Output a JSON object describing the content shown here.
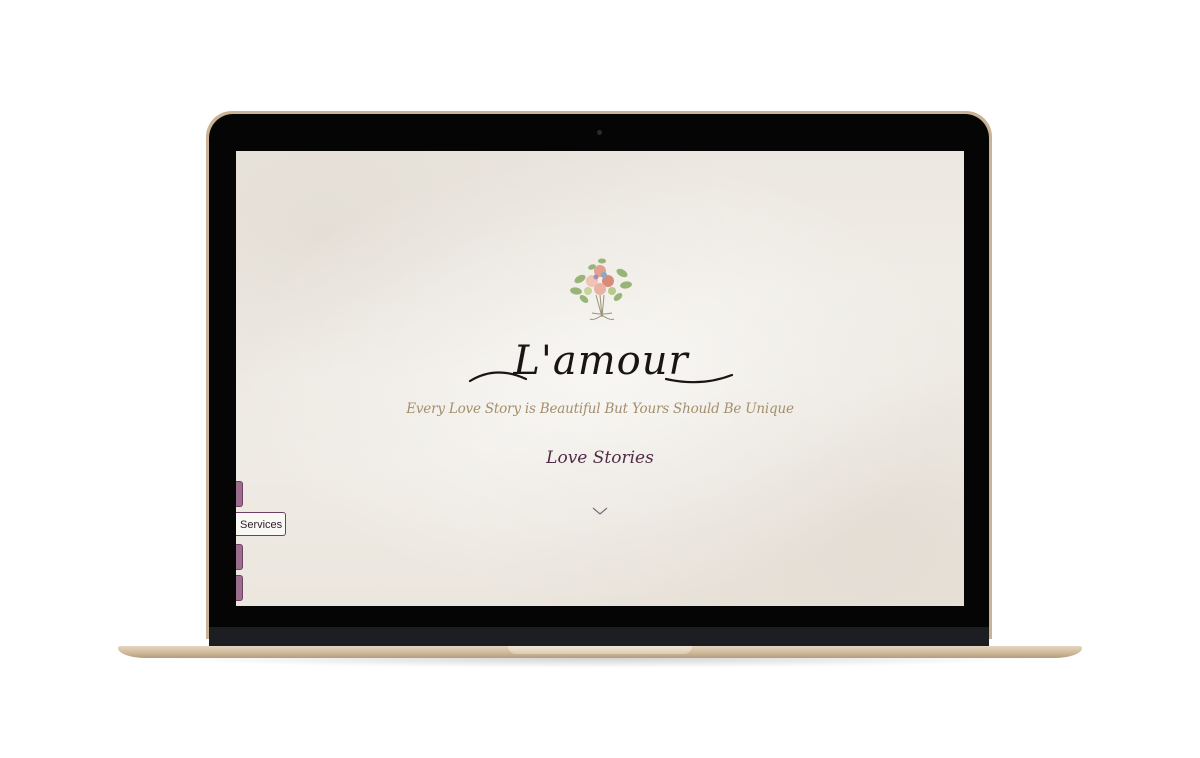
{
  "site": {
    "logo_text": "L'amour",
    "tagline": "Every Love Story is Beautiful But Yours Should Be Unique",
    "nav_link": "Love Stories",
    "scroll_icon": "chevron-down-icon"
  },
  "side_nav": {
    "items": [
      {
        "label": "",
        "active": false
      },
      {
        "label": "Services",
        "active": true
      },
      {
        "label": "",
        "active": false
      },
      {
        "label": "",
        "active": false
      }
    ]
  },
  "colors": {
    "accent_plum": "#4f2d47",
    "tagline_gold": "#a48f6c",
    "paper": "#efebe4",
    "laptop_gold": "#c8b394"
  }
}
